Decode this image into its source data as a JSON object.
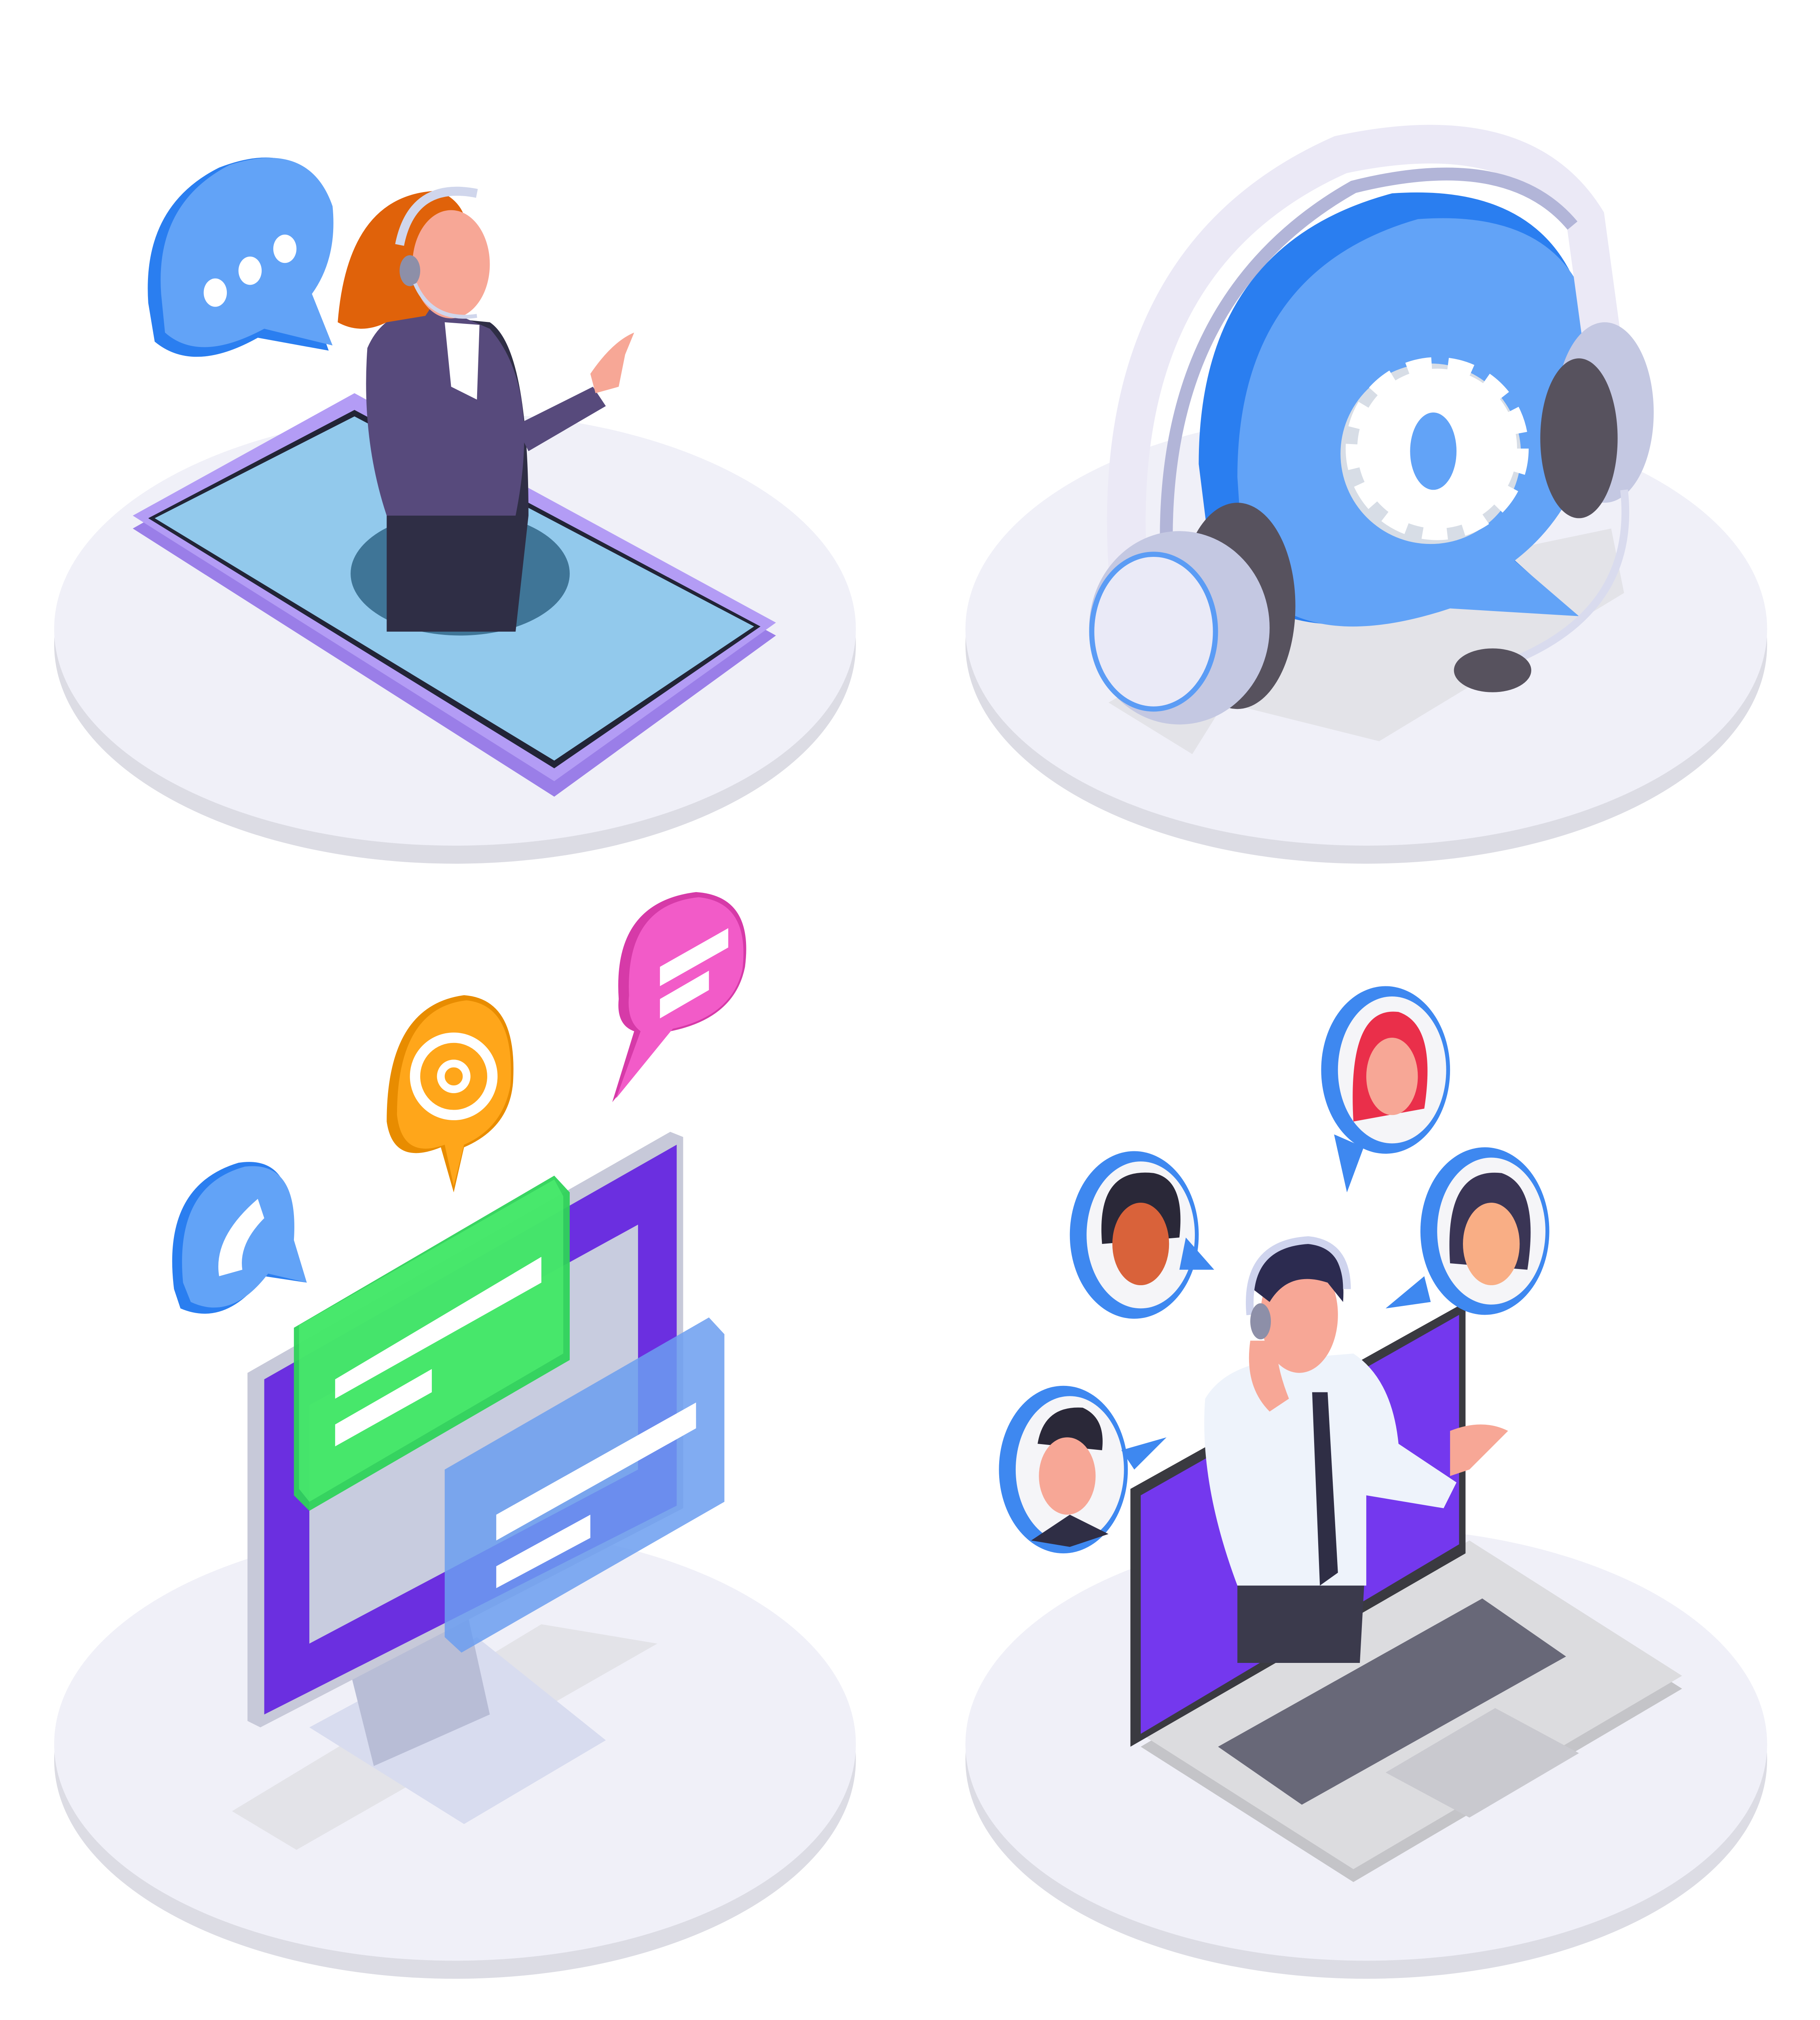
{
  "scenes": [
    {
      "name": "smartphone-operator",
      "icons": [
        "chat-bubble-icon",
        "smartphone-icon",
        "operator-woman-icon"
      ]
    },
    {
      "name": "support-headset",
      "icons": [
        "headset-icon",
        "speech-bubble-icon",
        "gear-icon"
      ]
    },
    {
      "name": "desktop-messaging",
      "icons": [
        "phone-bubble-icon",
        "email-at-bubble-icon",
        "message-bubble-icon",
        "monitor-icon",
        "chat-window-icon"
      ]
    },
    {
      "name": "laptop-operator",
      "icons": [
        "laptop-icon",
        "operator-man-icon",
        "customer-avatar-icon"
      ]
    }
  ],
  "colors": {
    "platform": "#f0f0f8",
    "platform_edge": "#dcdce4",
    "blue": "#5b9cf5",
    "blue_dark": "#2a7ef0",
    "purple": "#6b2fe0",
    "phone_frame": "#a98cf0",
    "phone_screen": "#8fc8ec",
    "green": "#3cdc5c",
    "orange": "#ffa61a",
    "pink": "#f25bc8",
    "suit": "#4f4670",
    "skin": "#f7a796",
    "hair_red": "#e0620a",
    "gray": "#d9d9de"
  }
}
